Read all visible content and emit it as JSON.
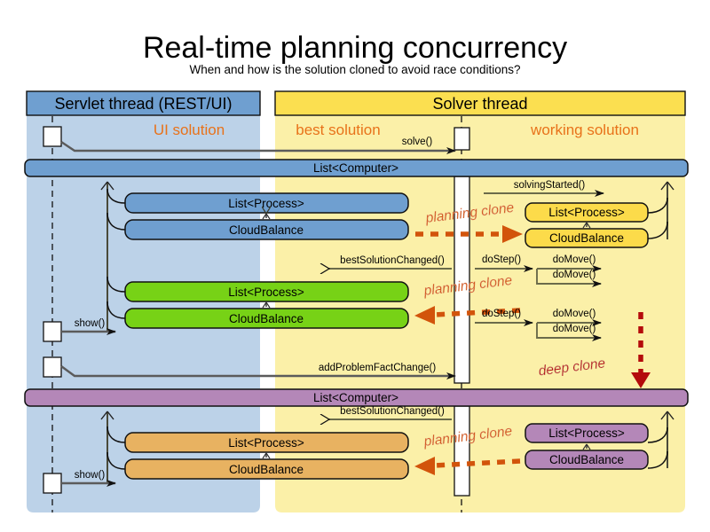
{
  "title": "Real-time planning concurrency",
  "subtitle": "When and how is the solution cloned to avoid race conditions?",
  "colors": {
    "servlet_header": "#6f9fd0",
    "servlet_lane": "#bcd2e8",
    "solver_header": "#fbdf50",
    "solver_lane": "#fbf0a8",
    "accent_orange": "#d2540b",
    "accent_red": "#b40b0b",
    "blue_box": "#6f9fd0",
    "green_box": "#77d216",
    "orange_box": "#e8b261",
    "purple_box": "#b487b8"
  },
  "lanes": [
    {
      "id": "servlet",
      "header": "Servlet thread (REST/UI)",
      "solution_label": "UI solution"
    },
    {
      "id": "solver",
      "header": "Solver thread",
      "solution_label_left": "best solution",
      "solution_label_right": "working solution"
    }
  ],
  "headers": {
    "servlet_thread": "Servlet thread (REST/UI)",
    "solver_thread": "Solver thread"
  },
  "solution_labels": {
    "ui": "UI solution",
    "best": "best solution",
    "working": "working solution"
  },
  "messages": {
    "solve": "solve()",
    "solving_started": "solvingStarted()",
    "do_step": "doStep()",
    "do_move": "doMove()",
    "best_solution_changed": "bestSolutionChanged()",
    "show": "show()",
    "add_problem_fact_change": "addProblemFactChange()"
  },
  "annotations": {
    "planning_clone": "planning clone",
    "deep_clone": "deep clone"
  },
  "objects": {
    "list_computer": "List<Computer>",
    "list_process": "List<Process>",
    "cloud_balance": "CloudBalance"
  },
  "snapshots": [
    {
      "id": "snapshot-1",
      "color": "#6f9fd0",
      "root": "List<Computer>",
      "left_boxes": [
        "List<Process>",
        "CloudBalance"
      ],
      "right_boxes": [
        "List<Process>",
        "CloudBalance"
      ],
      "right_color": "#fcdb4a"
    },
    {
      "id": "snapshot-2",
      "color": "#77d216",
      "left_boxes": [
        "List<Process>",
        "CloudBalance"
      ]
    },
    {
      "id": "snapshot-3",
      "color": "#b487b8",
      "root": "List<Computer>",
      "left_boxes": [
        "List<Process>",
        "CloudBalance"
      ],
      "right_boxes": [
        "List<Process>",
        "CloudBalance"
      ]
    }
  ],
  "chart_data": {
    "type": "diagram",
    "diagram_kind": "uml-sequence",
    "title": "Real-time planning concurrency",
    "lifelines": [
      "Servlet thread (REST/UI)",
      "Solver thread (best solution)",
      "Solver thread (working solution)"
    ],
    "messages": [
      {
        "order": 1,
        "from": "servlet",
        "to": "working",
        "label": "solve()"
      },
      {
        "order": 2,
        "from": "working",
        "to": "working",
        "label": "solvingStarted()"
      },
      {
        "order": 3,
        "from": "best",
        "to": "working",
        "label": "doStep()"
      },
      {
        "order": 4,
        "from": "working",
        "to": "working",
        "label": "doMove()"
      },
      {
        "order": 5,
        "from": "working",
        "to": "working",
        "label": "doMove()"
      },
      {
        "order": 6,
        "from": "working",
        "to": "best",
        "label": "bestSolutionChanged()"
      },
      {
        "order": 7,
        "from": "best",
        "to": "working",
        "label": "doStep()"
      },
      {
        "order": 8,
        "from": "working",
        "to": "working",
        "label": "doMove()"
      },
      {
        "order": 9,
        "from": "working",
        "to": "working",
        "label": "doMove()"
      },
      {
        "order": 10,
        "from": "servlet",
        "to": "servlet",
        "label": "show()"
      },
      {
        "order": 11,
        "from": "servlet",
        "to": "working",
        "label": "addProblemFactChange()"
      },
      {
        "order": 12,
        "from": "working",
        "to": "best",
        "label": "bestSolutionChanged()"
      },
      {
        "order": 13,
        "from": "servlet",
        "to": "servlet",
        "label": "show()"
      }
    ],
    "clone_annotations": [
      {
        "label": "planning clone",
        "direction": "right"
      },
      {
        "label": "planning clone",
        "direction": "left"
      },
      {
        "label": "deep clone",
        "direction": "down"
      },
      {
        "label": "planning clone",
        "direction": "left"
      }
    ]
  }
}
